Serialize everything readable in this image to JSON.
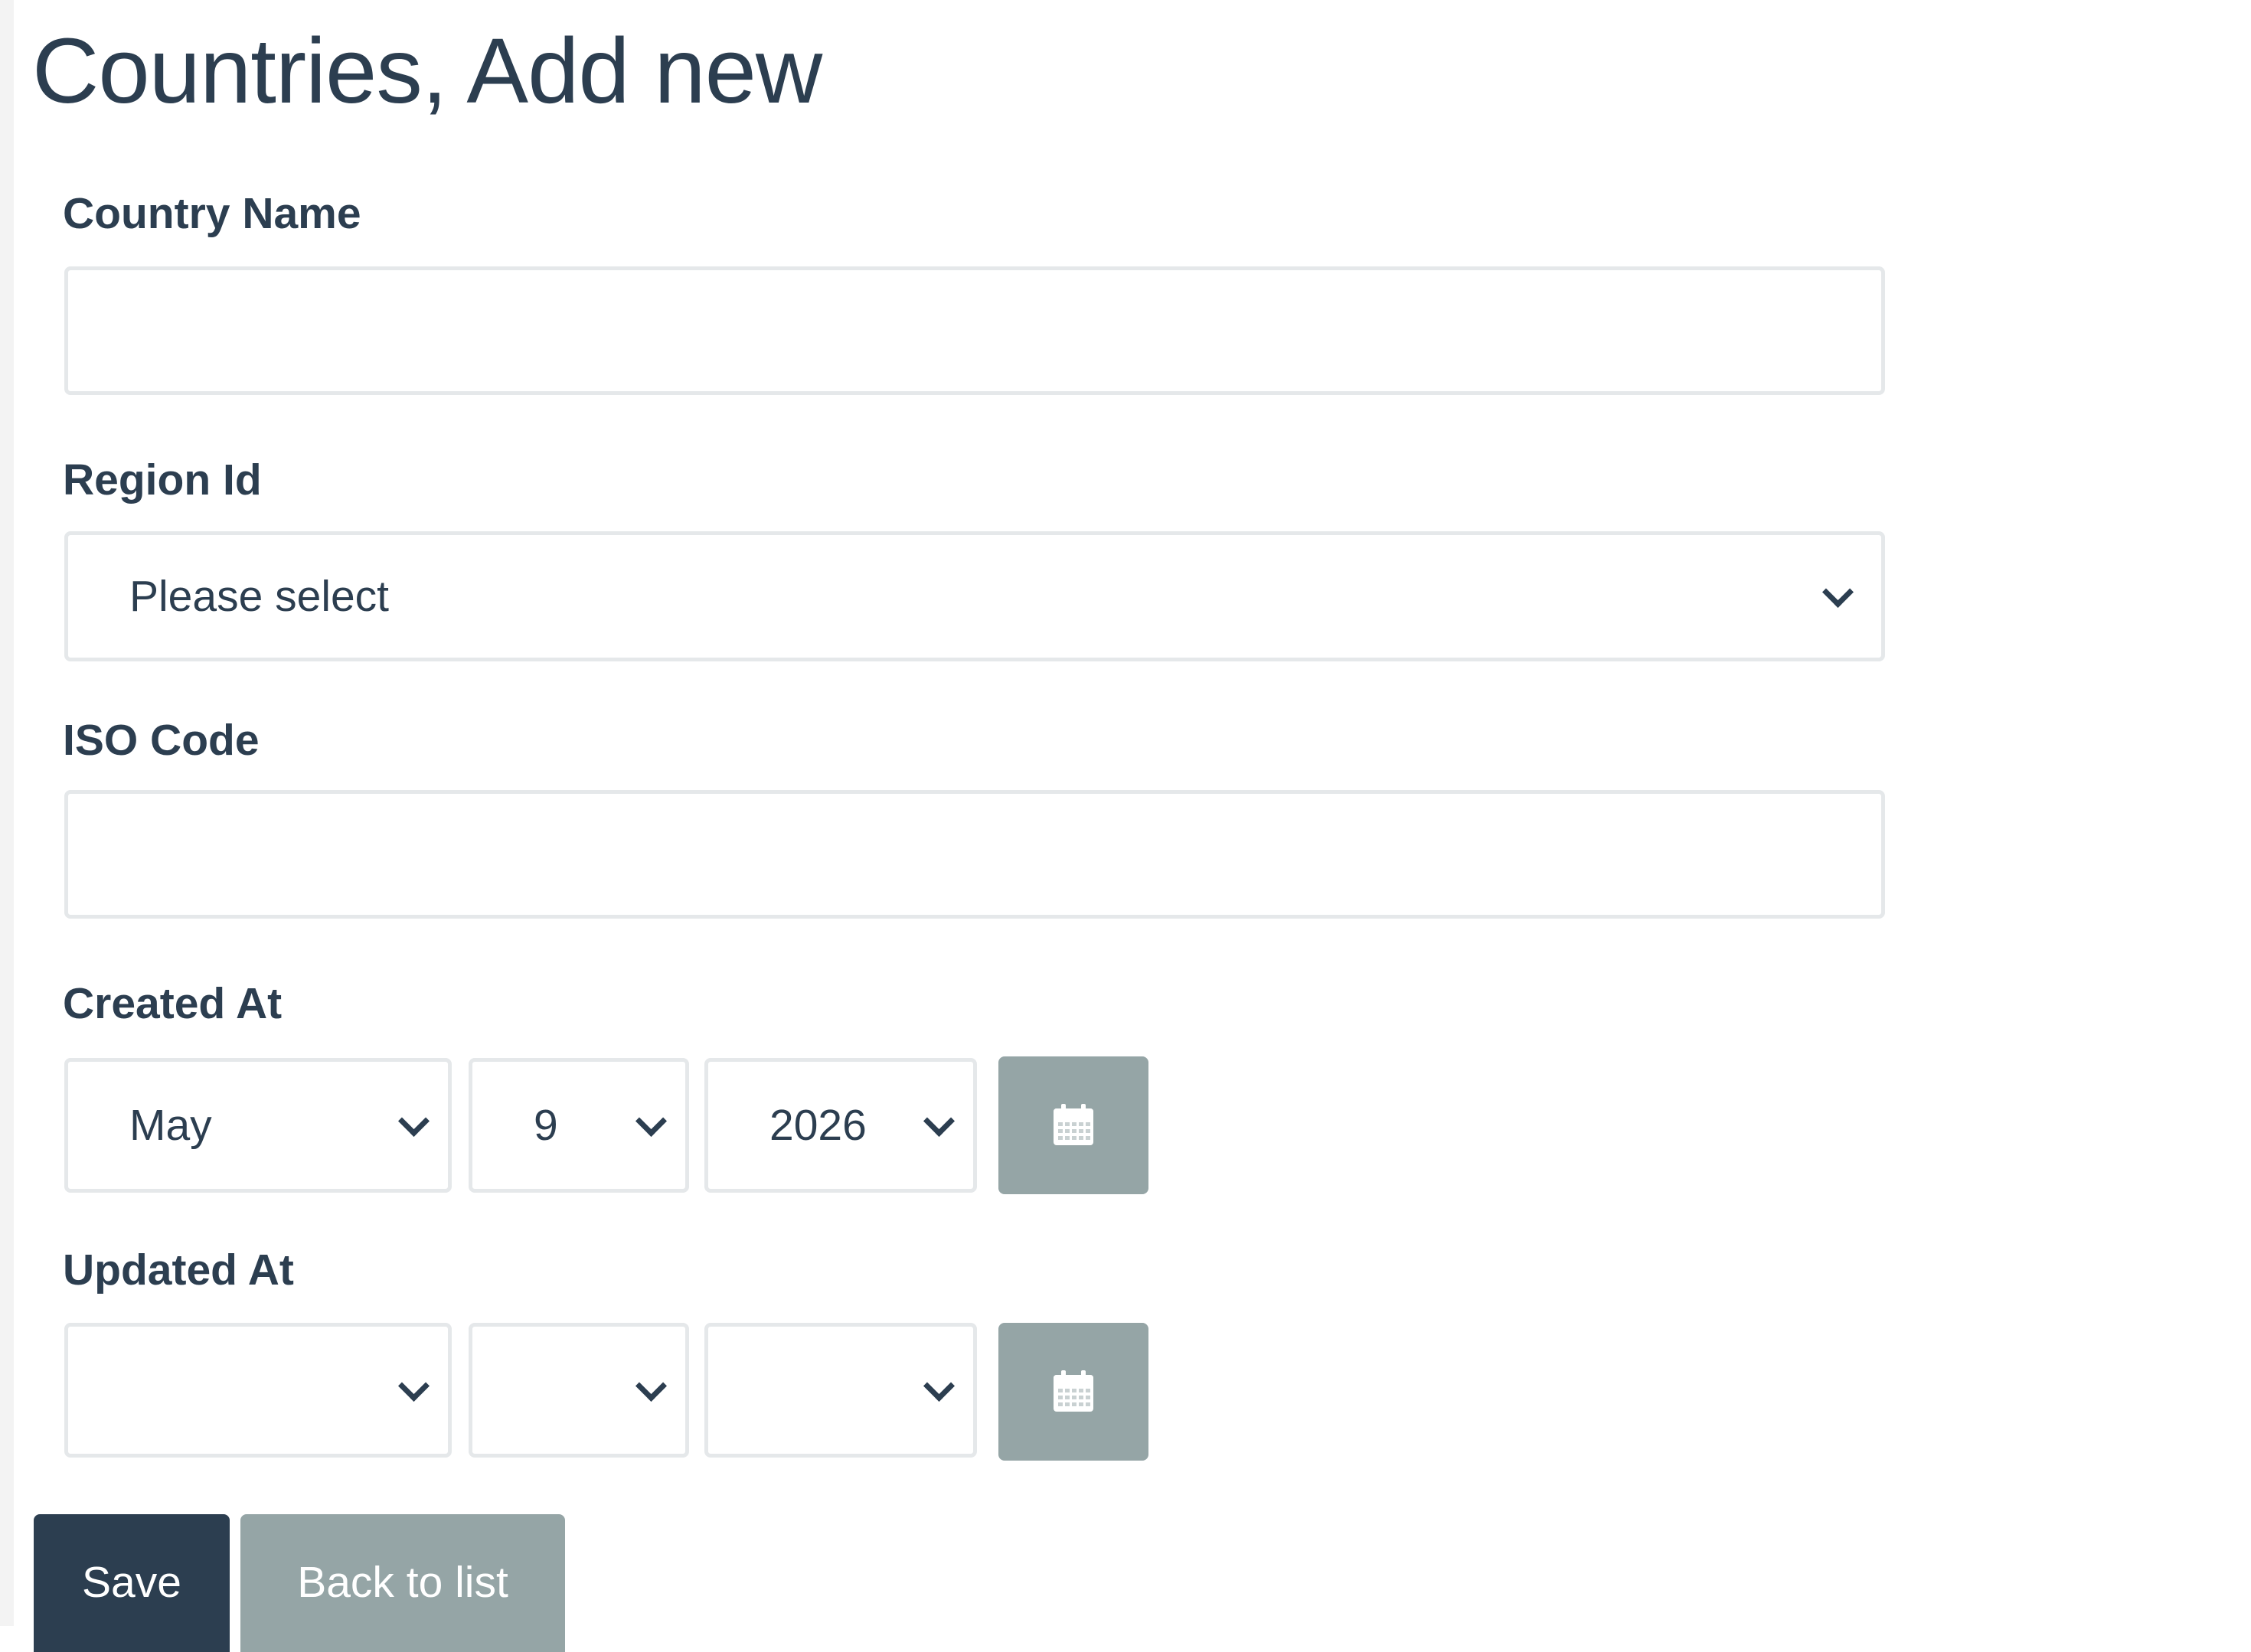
{
  "page": {
    "title": "Countries, Add new"
  },
  "form": {
    "country_name": {
      "label": "Country Name",
      "value": "",
      "placeholder": ""
    },
    "region_id": {
      "label": "Region Id",
      "selected": "Please select"
    },
    "iso_code": {
      "label": "ISO Code",
      "value": "",
      "placeholder": ""
    },
    "created_at": {
      "label": "Created At",
      "month": "May",
      "day": "9",
      "year": "2026"
    },
    "updated_at": {
      "label": "Updated At",
      "month": "",
      "day": "",
      "year": ""
    }
  },
  "actions": {
    "save_label": "Save",
    "back_label": "Back to list"
  },
  "colors": {
    "primary": "#2c3e50",
    "secondary": "#95a5a6",
    "border": "#e5e8ea"
  },
  "icons": {
    "calendar": "calendar-icon",
    "chevron": "chevron-down-icon"
  }
}
